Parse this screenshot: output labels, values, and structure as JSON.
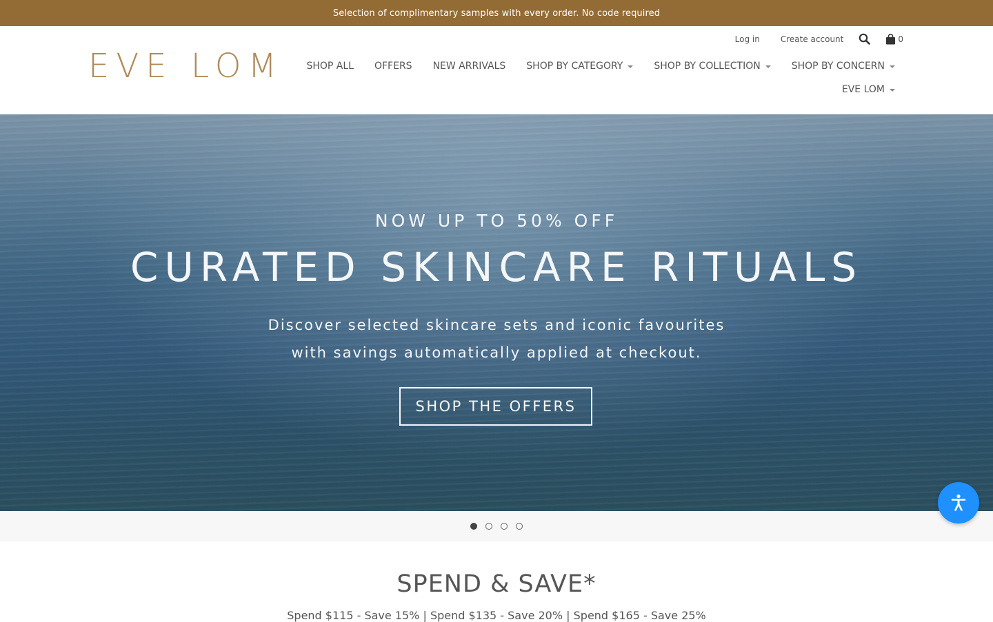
{
  "announcement": "Selection of complimentary samples with every order. No code required",
  "logo": "EVE LOM",
  "utility": {
    "login": "Log in",
    "create_account": "Create account",
    "cart_count": "0"
  },
  "nav": {
    "row1": [
      "SHOP ALL",
      "OFFERS",
      "NEW ARRIVALS",
      "SHOP BY CATEGORY",
      "SHOP BY COLLECTION",
      "SHOP BY CONCERN"
    ],
    "row2": [
      "EVE LOM"
    ]
  },
  "hero": {
    "kicker": "NOW UP TO 50% OFF",
    "title": "CURATED SKINCARE RITUALS",
    "desc_line1": "Discover selected skincare sets and iconic favourites",
    "desc_line2": "with savings automatically applied at checkout.",
    "cta": "SHOP THE OFFERS"
  },
  "slider": {
    "count": 4,
    "active": 1
  },
  "promo": {
    "title": "SPEND & SAVE*",
    "subtitle": "Spend $115 - Save 15% | Spend $135 - Save 20% | Spend $165 - Save 25%"
  },
  "colors": {
    "announcement_bg": "#926b35",
    "logo": "#b08a5a",
    "accessibility": "#1e90ff"
  },
  "icons": [
    "search-icon",
    "shopping-bag-icon",
    "caret-down-icon",
    "accessibility-icon"
  ]
}
